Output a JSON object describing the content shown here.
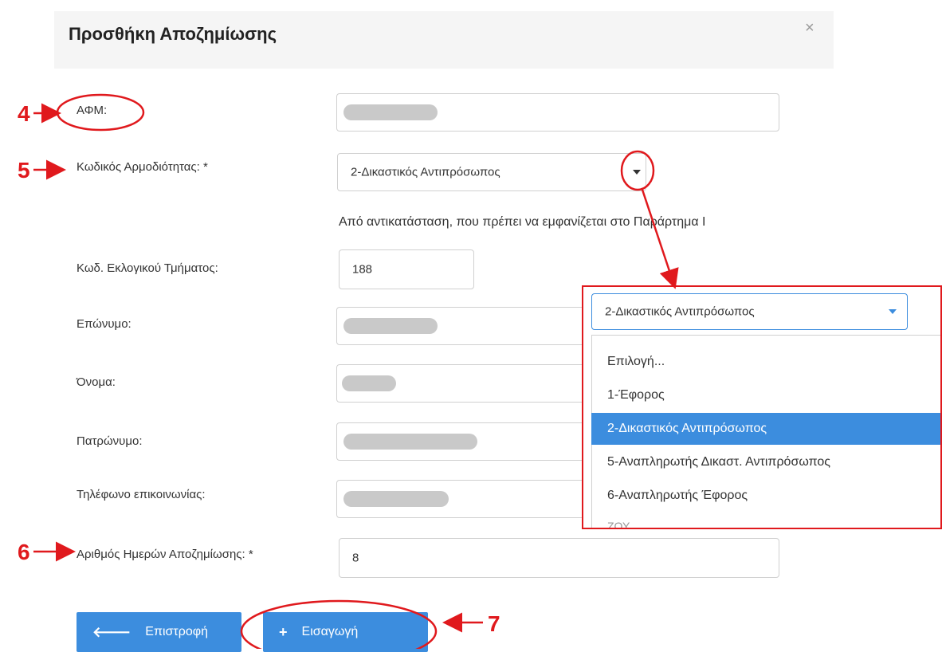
{
  "modal": {
    "title": "Προσθήκη Αποζημίωσης",
    "close_glyph": "×"
  },
  "form": {
    "afm": {
      "label": "ΑΦΜ:"
    },
    "kodikos": {
      "label": "Κωδικός Αρμοδιότητας: *",
      "value": "2-Δικαστικός Αντιπρόσωπος",
      "hint": "Από αντικατάσταση, που πρέπει να εμφανίζεται στο Παράρτημα Ι"
    },
    "tmima": {
      "label": "Κωδ. Εκλογικού Τμήματος:",
      "value": "188"
    },
    "eponymo": {
      "label": "Επώνυμο:"
    },
    "onoma": {
      "label": "Όνομα:"
    },
    "patronymo": {
      "label": "Πατρώνυμο:"
    },
    "tilefono": {
      "label": "Τηλέφωνο επικοινωνίας:"
    },
    "imeres": {
      "label": "Αριθμός Ημερών Αποζημίωσης: *",
      "value": "8"
    }
  },
  "buttons": {
    "back": {
      "icon": "arrow-left-icon",
      "glyph": "🡐",
      "label": "Επιστροφή"
    },
    "insert": {
      "icon": "plus-icon",
      "glyph": "+",
      "label": "Εισαγωγή"
    }
  },
  "dropdown": {
    "selected": "2-Δικαστικός Αντιπρόσωπος",
    "options": [
      "Επιλογή...",
      "1-Έφορος",
      "2-Δικαστικός Αντιπρόσωπος",
      "5-Αναπληρωτής Δικαστ. Αντιπρόσωπος",
      "6-Αναπληρωτής Έφορος"
    ],
    "selected_index": 2,
    "partial_text": "ΖΟΥ"
  },
  "annotations": {
    "n4": "4",
    "n5": "5",
    "n6": "6",
    "n7": "7"
  },
  "colors": {
    "accent": "#3c8dde",
    "annotation": "#e0191d",
    "header_bg": "#f5f5f5"
  }
}
